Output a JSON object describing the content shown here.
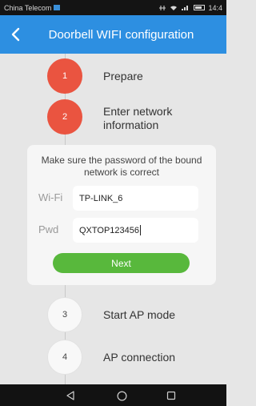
{
  "status_bar": {
    "carrier": "China Telecom",
    "time": "14:4"
  },
  "app_bar": {
    "back_icon": "chevron-left-icon",
    "title": "Doorbell WIFI configuration"
  },
  "steps": [
    {
      "number": "1",
      "label": "Prepare",
      "state": "done"
    },
    {
      "number": "2",
      "label": "Enter network information",
      "label_line1": "Enter network",
      "label_line2": "information",
      "state": "active"
    },
    {
      "number": "3",
      "label": "Start AP mode",
      "state": "pending"
    },
    {
      "number": "4",
      "label": "AP connection",
      "state": "pending"
    }
  ],
  "form": {
    "notice": "Make sure the password of the bound network is correct",
    "wifi_label": "Wi-Fi",
    "wifi_value": "TP-LINK_6",
    "pwd_label": "Pwd",
    "pwd_value": "QXTOP123456",
    "next_label": "Next"
  },
  "colors": {
    "app_bar": "#2d8fe1",
    "active_step": "#ea5440",
    "next_button": "#58b83c"
  },
  "nav_bar": {
    "back_icon": "triangle-back-icon",
    "home_icon": "circle-home-icon",
    "recents_icon": "square-recents-icon"
  }
}
